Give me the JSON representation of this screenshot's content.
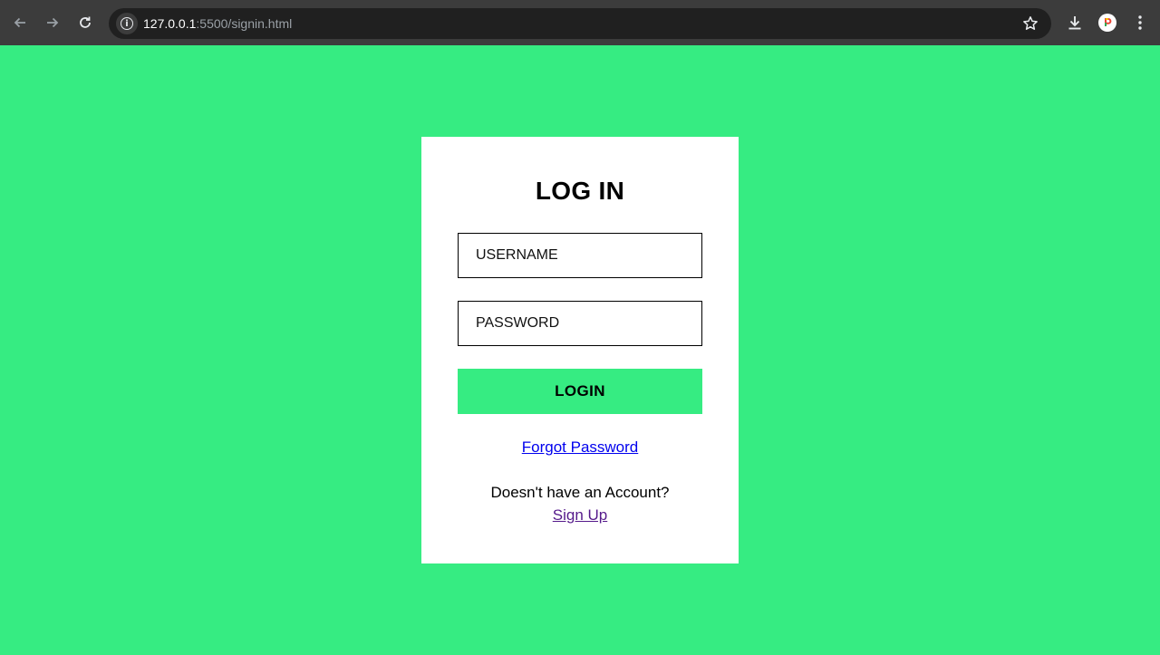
{
  "browser": {
    "url_host": "127.0.0.1",
    "url_rest": ":5500/signin.html",
    "icons": {
      "back": "back-arrow-icon",
      "forward": "forward-arrow-icon",
      "reload": "reload-icon",
      "info": "info-icon",
      "bookmark": "star-icon",
      "download": "download-icon",
      "profile": "profile-icon",
      "menu": "kebab-menu-icon"
    }
  },
  "colors": {
    "page_background": "#36ec82",
    "card_background": "#ffffff",
    "button_background": "#36ec82",
    "link_unvisited": "#0000ee",
    "link_visited": "#551a8b"
  },
  "login": {
    "title": "LOG IN",
    "username_placeholder": "USERNAME",
    "password_placeholder": "PASSWORD",
    "button_label": "LOGIN",
    "forgot_link": "Forgot Password",
    "no_account_text": "Doesn't have an Account?",
    "signup_link": "Sign Up"
  }
}
